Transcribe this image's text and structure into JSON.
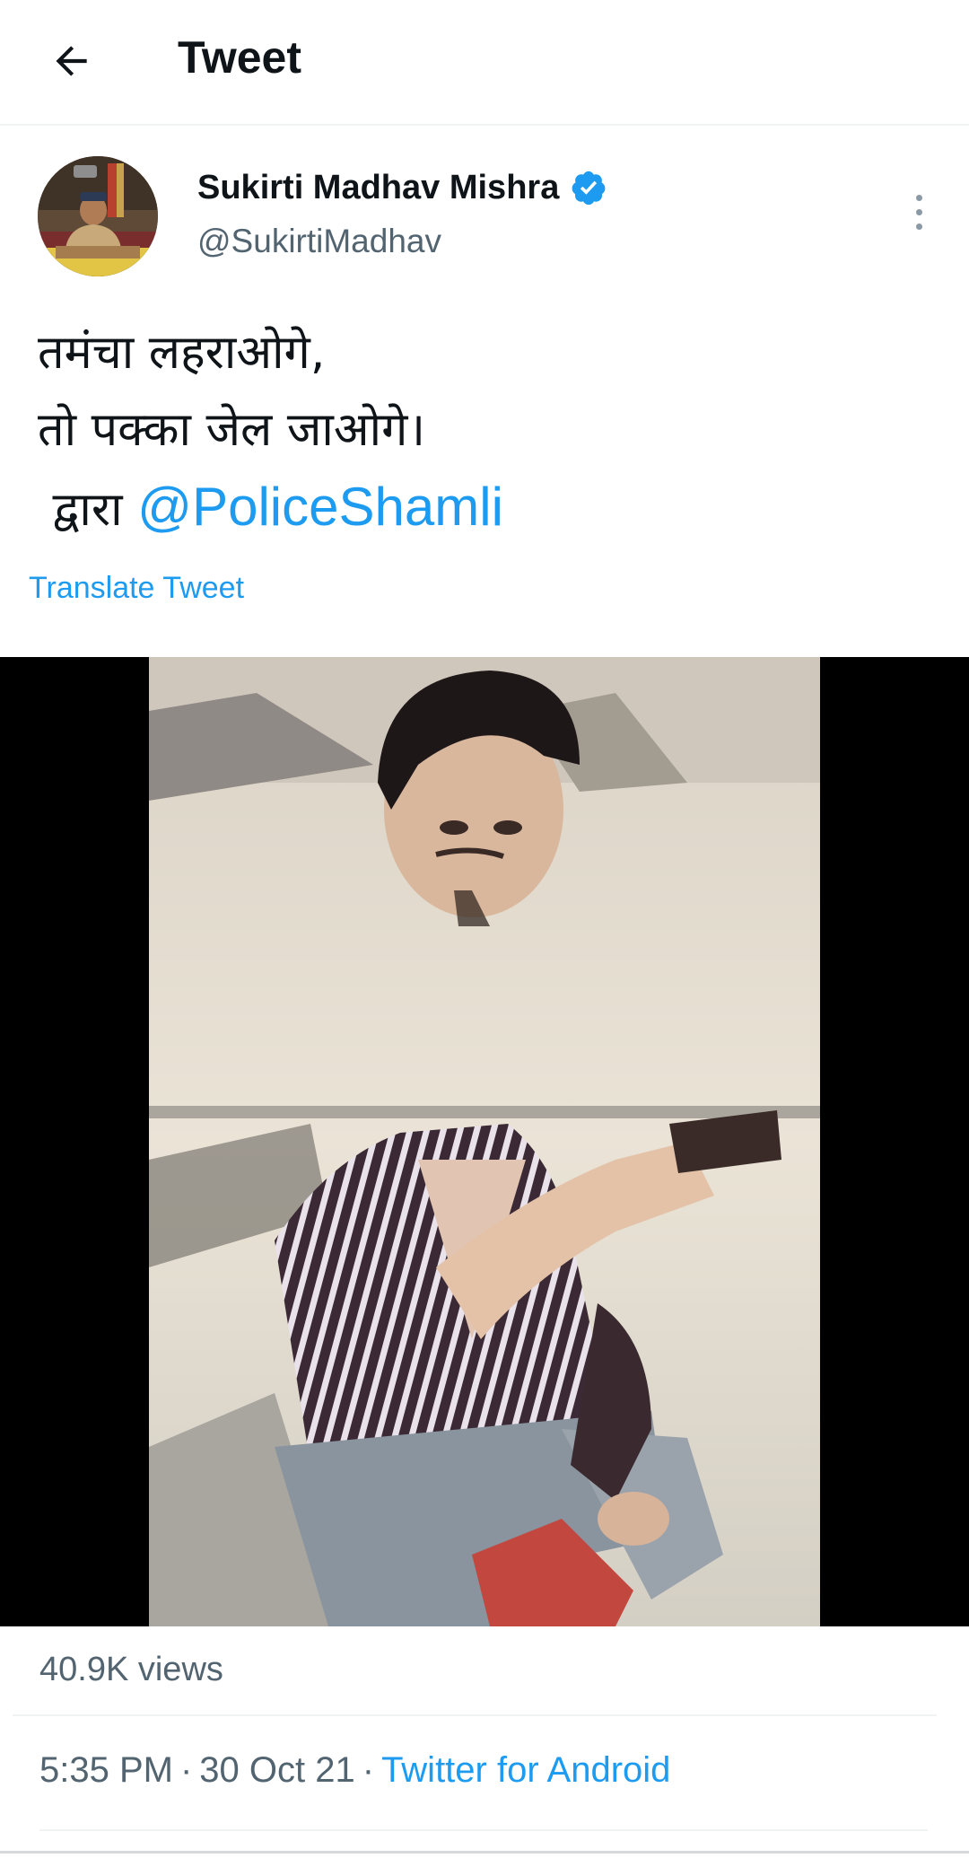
{
  "header": {
    "back_icon": "arrow-left-icon",
    "title": "Tweet"
  },
  "author": {
    "display_name": "Sukirti Madhav Mishra",
    "handle": "@SukirtiMadhav",
    "verified": true,
    "verified_icon": "verified-badge-icon",
    "more_icon": "more-vertical-icon"
  },
  "tweet": {
    "lines": [
      "तमंचा लहराओगे,",
      "तो पक्का जेल जाओगे।",
      " द्वारा "
    ],
    "mention": "@PoliceShamli",
    "translate_label": "Translate Tweet"
  },
  "media": {
    "type": "video"
  },
  "stats": {
    "views": "40.9K views"
  },
  "meta": {
    "time": "5:35 PM",
    "separator": "·",
    "date": "30 Oct 21",
    "source": "Twitter for Android"
  },
  "colors": {
    "accent": "#1d9bf0",
    "secondary_text": "#536471",
    "primary_text": "#0f1419",
    "divider": "#eff3f4"
  }
}
